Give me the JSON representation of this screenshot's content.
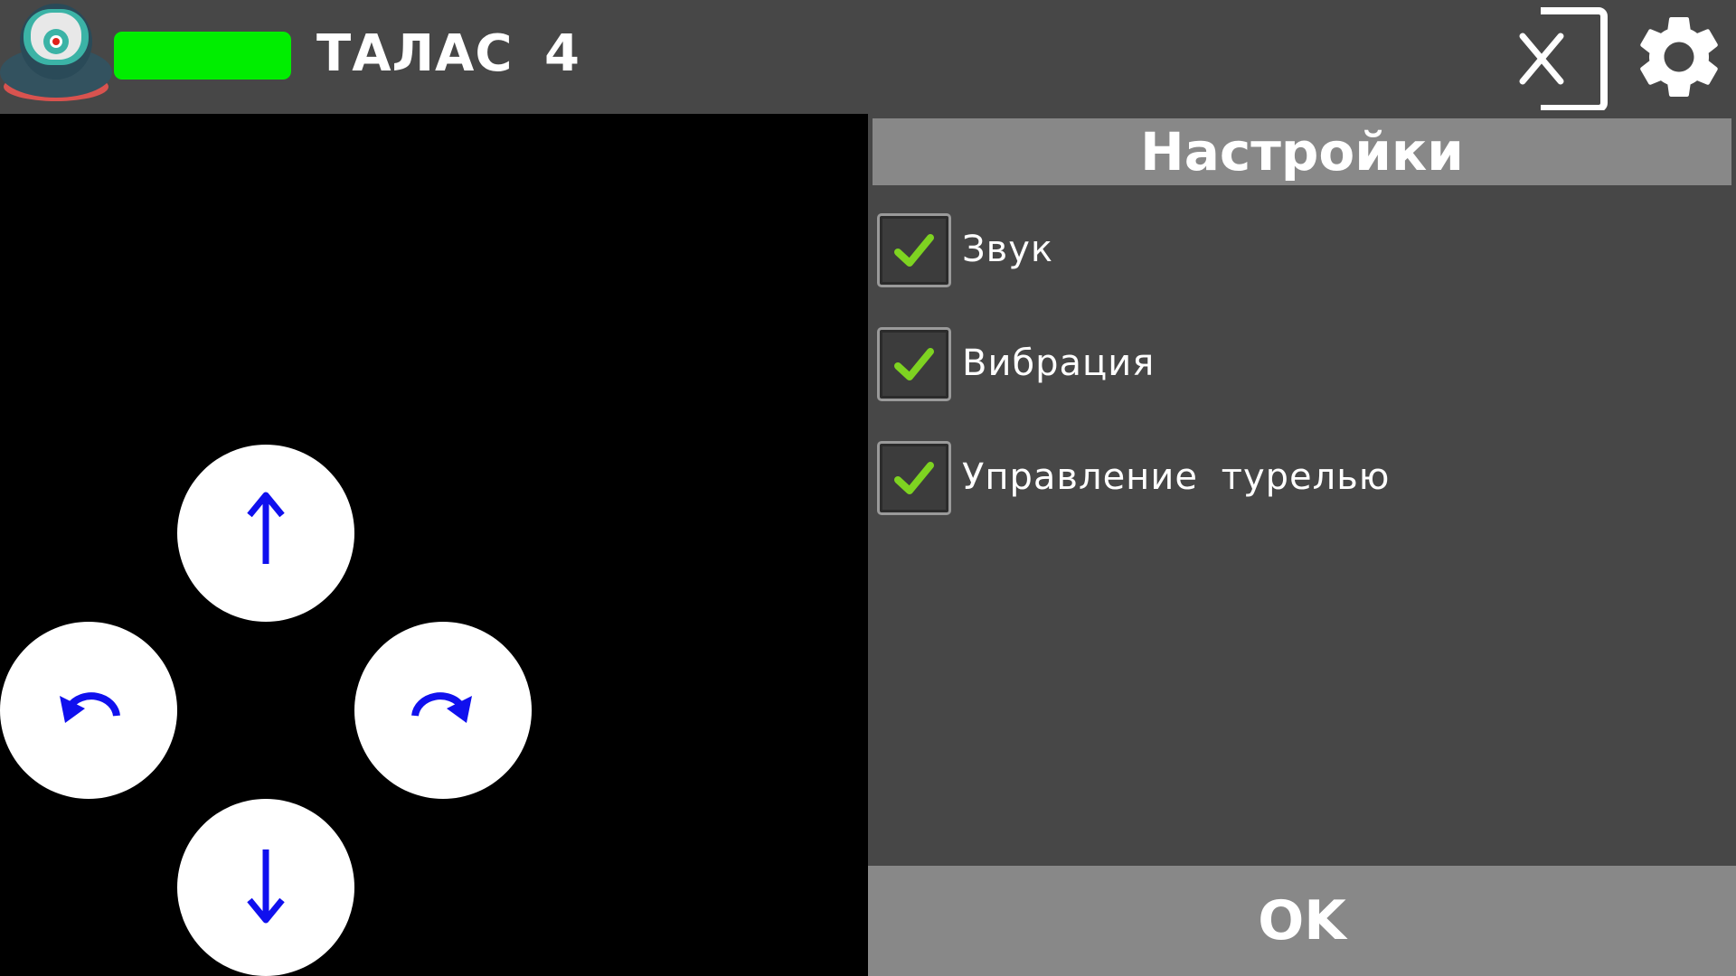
{
  "topbar": {
    "robot_name": "ТАЛАС 4",
    "battery_level": 1.0,
    "battery_color": "#00ee00",
    "avatar_icon": "robot-icon",
    "exit_icon": "exit-icon",
    "settings_icon": "gear-icon"
  },
  "controls": {
    "up_icon": "arrow-up-icon",
    "down_icon": "arrow-down-icon",
    "rotate_left_icon": "rotate-left-icon",
    "rotate_right_icon": "rotate-right-icon",
    "arrow_color": "#1010ee"
  },
  "settings": {
    "title": "Настройки",
    "options": [
      {
        "label": "Звук",
        "checked": true
      },
      {
        "label": "Вибрация",
        "checked": true
      },
      {
        "label": "Управление турелью",
        "checked": true
      }
    ],
    "ok_label": "OK"
  },
  "colors": {
    "bar_bg": "#474747",
    "panel_header": "#888888",
    "check_color": "#7ed321"
  }
}
